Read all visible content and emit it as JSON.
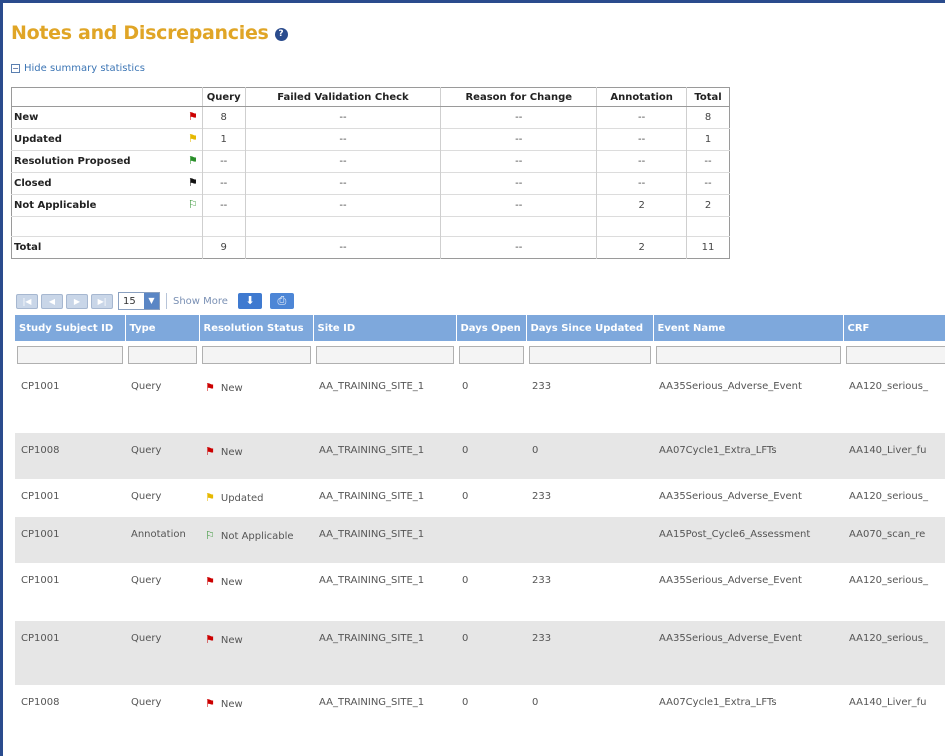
{
  "page": {
    "title": "Notes and Discrepancies",
    "summary_toggle": "Hide summary statistics"
  },
  "colors": {
    "title": "#e0a526",
    "header_bg": "#7ea8dc",
    "flag_new": "#cc0000",
    "flag_updated": "#e6b800",
    "flag_proposed": "#2a8f2a",
    "flag_closed": "#111111",
    "flag_na": "#2a8f2a"
  },
  "summary": {
    "headers": [
      "",
      "Query",
      "Failed Validation Check",
      "Reason for Change",
      "Annotation",
      "Total"
    ],
    "rows": [
      {
        "label": "New",
        "flag": "red-flag-icon",
        "values": [
          "8",
          "--",
          "--",
          "--",
          "8"
        ]
      },
      {
        "label": "Updated",
        "flag": "yellow-flag-icon",
        "values": [
          "1",
          "--",
          "--",
          "--",
          "1"
        ]
      },
      {
        "label": "Resolution Proposed",
        "flag": "green-flag-icon",
        "values": [
          "--",
          "--",
          "--",
          "--",
          "--"
        ]
      },
      {
        "label": "Closed",
        "flag": "black-flag-icon",
        "values": [
          "--",
          "--",
          "--",
          "--",
          "--"
        ]
      },
      {
        "label": "Not Applicable",
        "flag": "outline-flag-icon",
        "values": [
          "--",
          "--",
          "--",
          "2",
          "2"
        ]
      }
    ],
    "total": {
      "label": "Total",
      "values": [
        "9",
        "--",
        "--",
        "2",
        "11"
      ]
    }
  },
  "toolbar": {
    "page_size": "15",
    "show_more": "Show More"
  },
  "grid": {
    "columns": [
      "Study Subject ID",
      "Type",
      "Resolution Status",
      "Site ID",
      "Days Open",
      "Days Since Updated",
      "Event Name",
      "CRF"
    ],
    "rows": [
      {
        "subject": "CP1001",
        "type": "Query",
        "status": "New",
        "site": "AA_TRAINING_SITE_1",
        "days_open": "0",
        "days_updated": "233",
        "event": "AA35Serious_Adverse_Event",
        "crf": "AA120_serious_"
      },
      {
        "subject": "CP1008",
        "type": "Query",
        "status": "New",
        "site": "AA_TRAINING_SITE_1",
        "days_open": "0",
        "days_updated": "0",
        "event": "AA07Cycle1_Extra_LFTs",
        "crf": "AA140_Liver_fu"
      },
      {
        "subject": "CP1001",
        "type": "Query",
        "status": "Updated",
        "site": "AA_TRAINING_SITE_1",
        "days_open": "0",
        "days_updated": "233",
        "event": "AA35Serious_Adverse_Event",
        "crf": "AA120_serious_"
      },
      {
        "subject": "CP1001",
        "type": "Annotation",
        "status": "Not Applicable",
        "site": "AA_TRAINING_SITE_1",
        "days_open": "",
        "days_updated": "",
        "event": "AA15Post_Cycle6_Assessment",
        "crf": "AA070_scan_re"
      },
      {
        "subject": "CP1001",
        "type": "Query",
        "status": "New",
        "site": "AA_TRAINING_SITE_1",
        "days_open": "0",
        "days_updated": "233",
        "event": "AA35Serious_Adverse_Event",
        "crf": "AA120_serious_"
      },
      {
        "subject": "CP1001",
        "type": "Query",
        "status": "New",
        "site": "AA_TRAINING_SITE_1",
        "days_open": "0",
        "days_updated": "233",
        "event": "AA35Serious_Adverse_Event",
        "crf": "AA120_serious_"
      },
      {
        "subject": "CP1008",
        "type": "Query",
        "status": "New",
        "site": "AA_TRAINING_SITE_1",
        "days_open": "0",
        "days_updated": "0",
        "event": "AA07Cycle1_Extra_LFTs",
        "crf": "AA140_Liver_fu"
      }
    ]
  }
}
